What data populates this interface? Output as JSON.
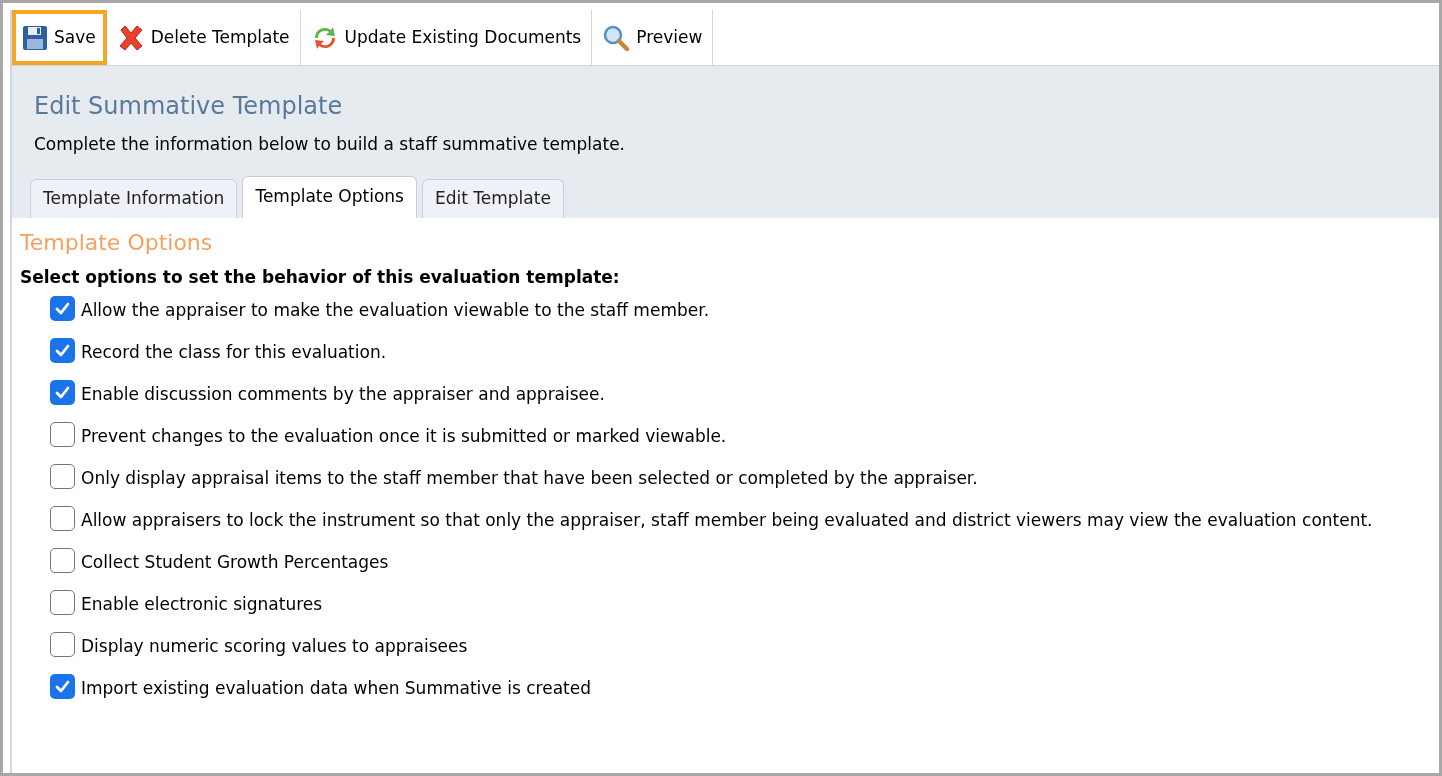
{
  "toolbar": [
    {
      "kind": "save",
      "label": "Save",
      "highlighted": true
    },
    {
      "kind": "delete",
      "label": "Delete Template",
      "highlighted": false
    },
    {
      "kind": "update",
      "label": "Update Existing Documents",
      "highlighted": false
    },
    {
      "kind": "preview",
      "label": "Preview",
      "highlighted": false
    }
  ],
  "header": {
    "title": "Edit Summative Template",
    "subtitle": "Complete the information below to build a staff summative template."
  },
  "tabs": [
    {
      "label": "Template Information",
      "selected": false
    },
    {
      "label": "Template Options",
      "selected": true
    },
    {
      "label": "Edit Template",
      "selected": false
    }
  ],
  "section": {
    "title": "Template Options",
    "instruction": "Select options to set the behavior of this evaluation template:"
  },
  "options": [
    {
      "label": "Allow the appraiser to make the evaluation viewable to the staff member.",
      "checked": true
    },
    {
      "label": "Record the class for this evaluation.",
      "checked": true
    },
    {
      "label": "Enable discussion comments by the appraiser and appraisee.",
      "checked": true
    },
    {
      "label": "Prevent changes to the evaluation once it is submitted or marked viewable.",
      "checked": false
    },
    {
      "label": "Only display appraisal items to the staff member that have been selected or completed by the appraiser.",
      "checked": false
    },
    {
      "label": "Allow appraisers to lock the instrument so that only the appraiser, staff member being evaluated and district viewers may view the evaluation content.",
      "checked": false
    },
    {
      "label": "Collect Student Growth Percentages",
      "checked": false
    },
    {
      "label": "Enable electronic signatures",
      "checked": false
    },
    {
      "label": "Display numeric scoring values to appraisees",
      "checked": false
    },
    {
      "label": "Import existing evaluation data when Summative is created",
      "checked": true
    }
  ]
}
